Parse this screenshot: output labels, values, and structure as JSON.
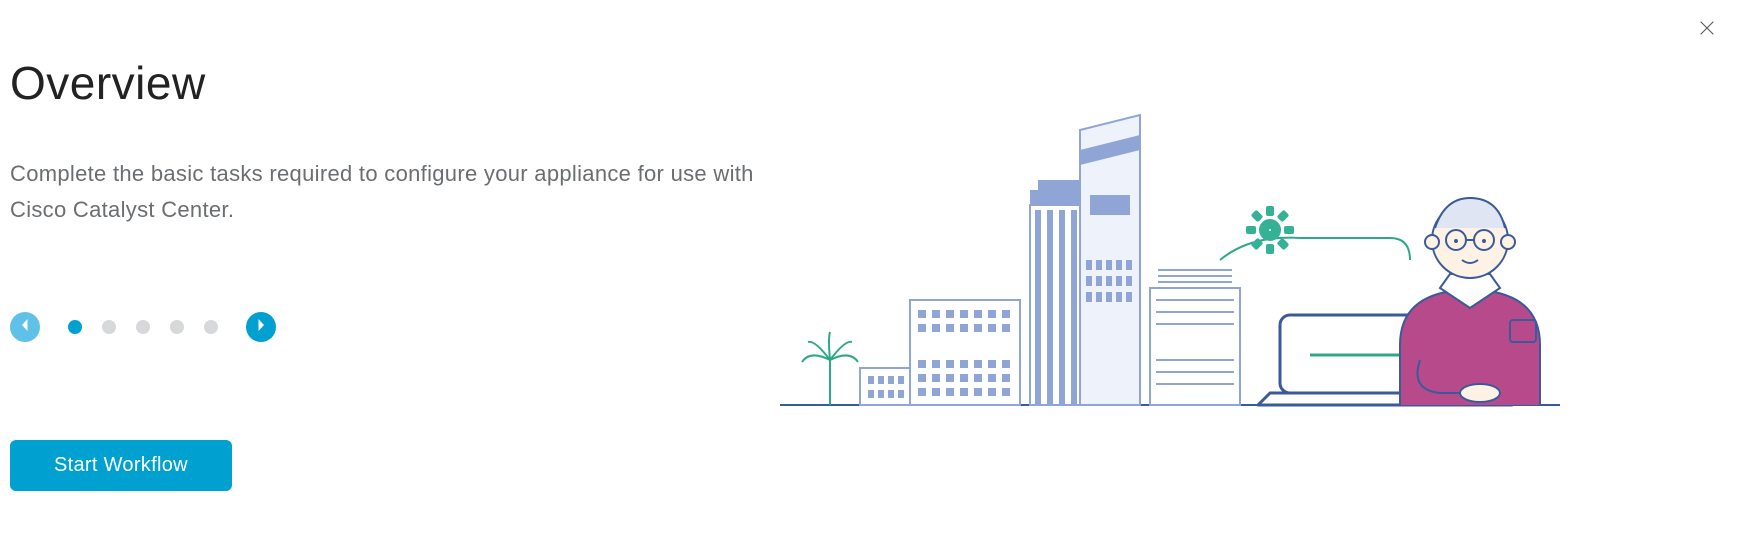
{
  "header": {
    "title": "Overview",
    "description": "Complete the basic tasks required to configure your appliance for use with Cisco Catalyst Center."
  },
  "carousel": {
    "total": 5,
    "active_index": 0
  },
  "actions": {
    "start_label": "Start Workflow"
  },
  "icons": {
    "close": "close-icon",
    "prev": "chevron-left-icon",
    "next": "chevron-right-icon"
  }
}
